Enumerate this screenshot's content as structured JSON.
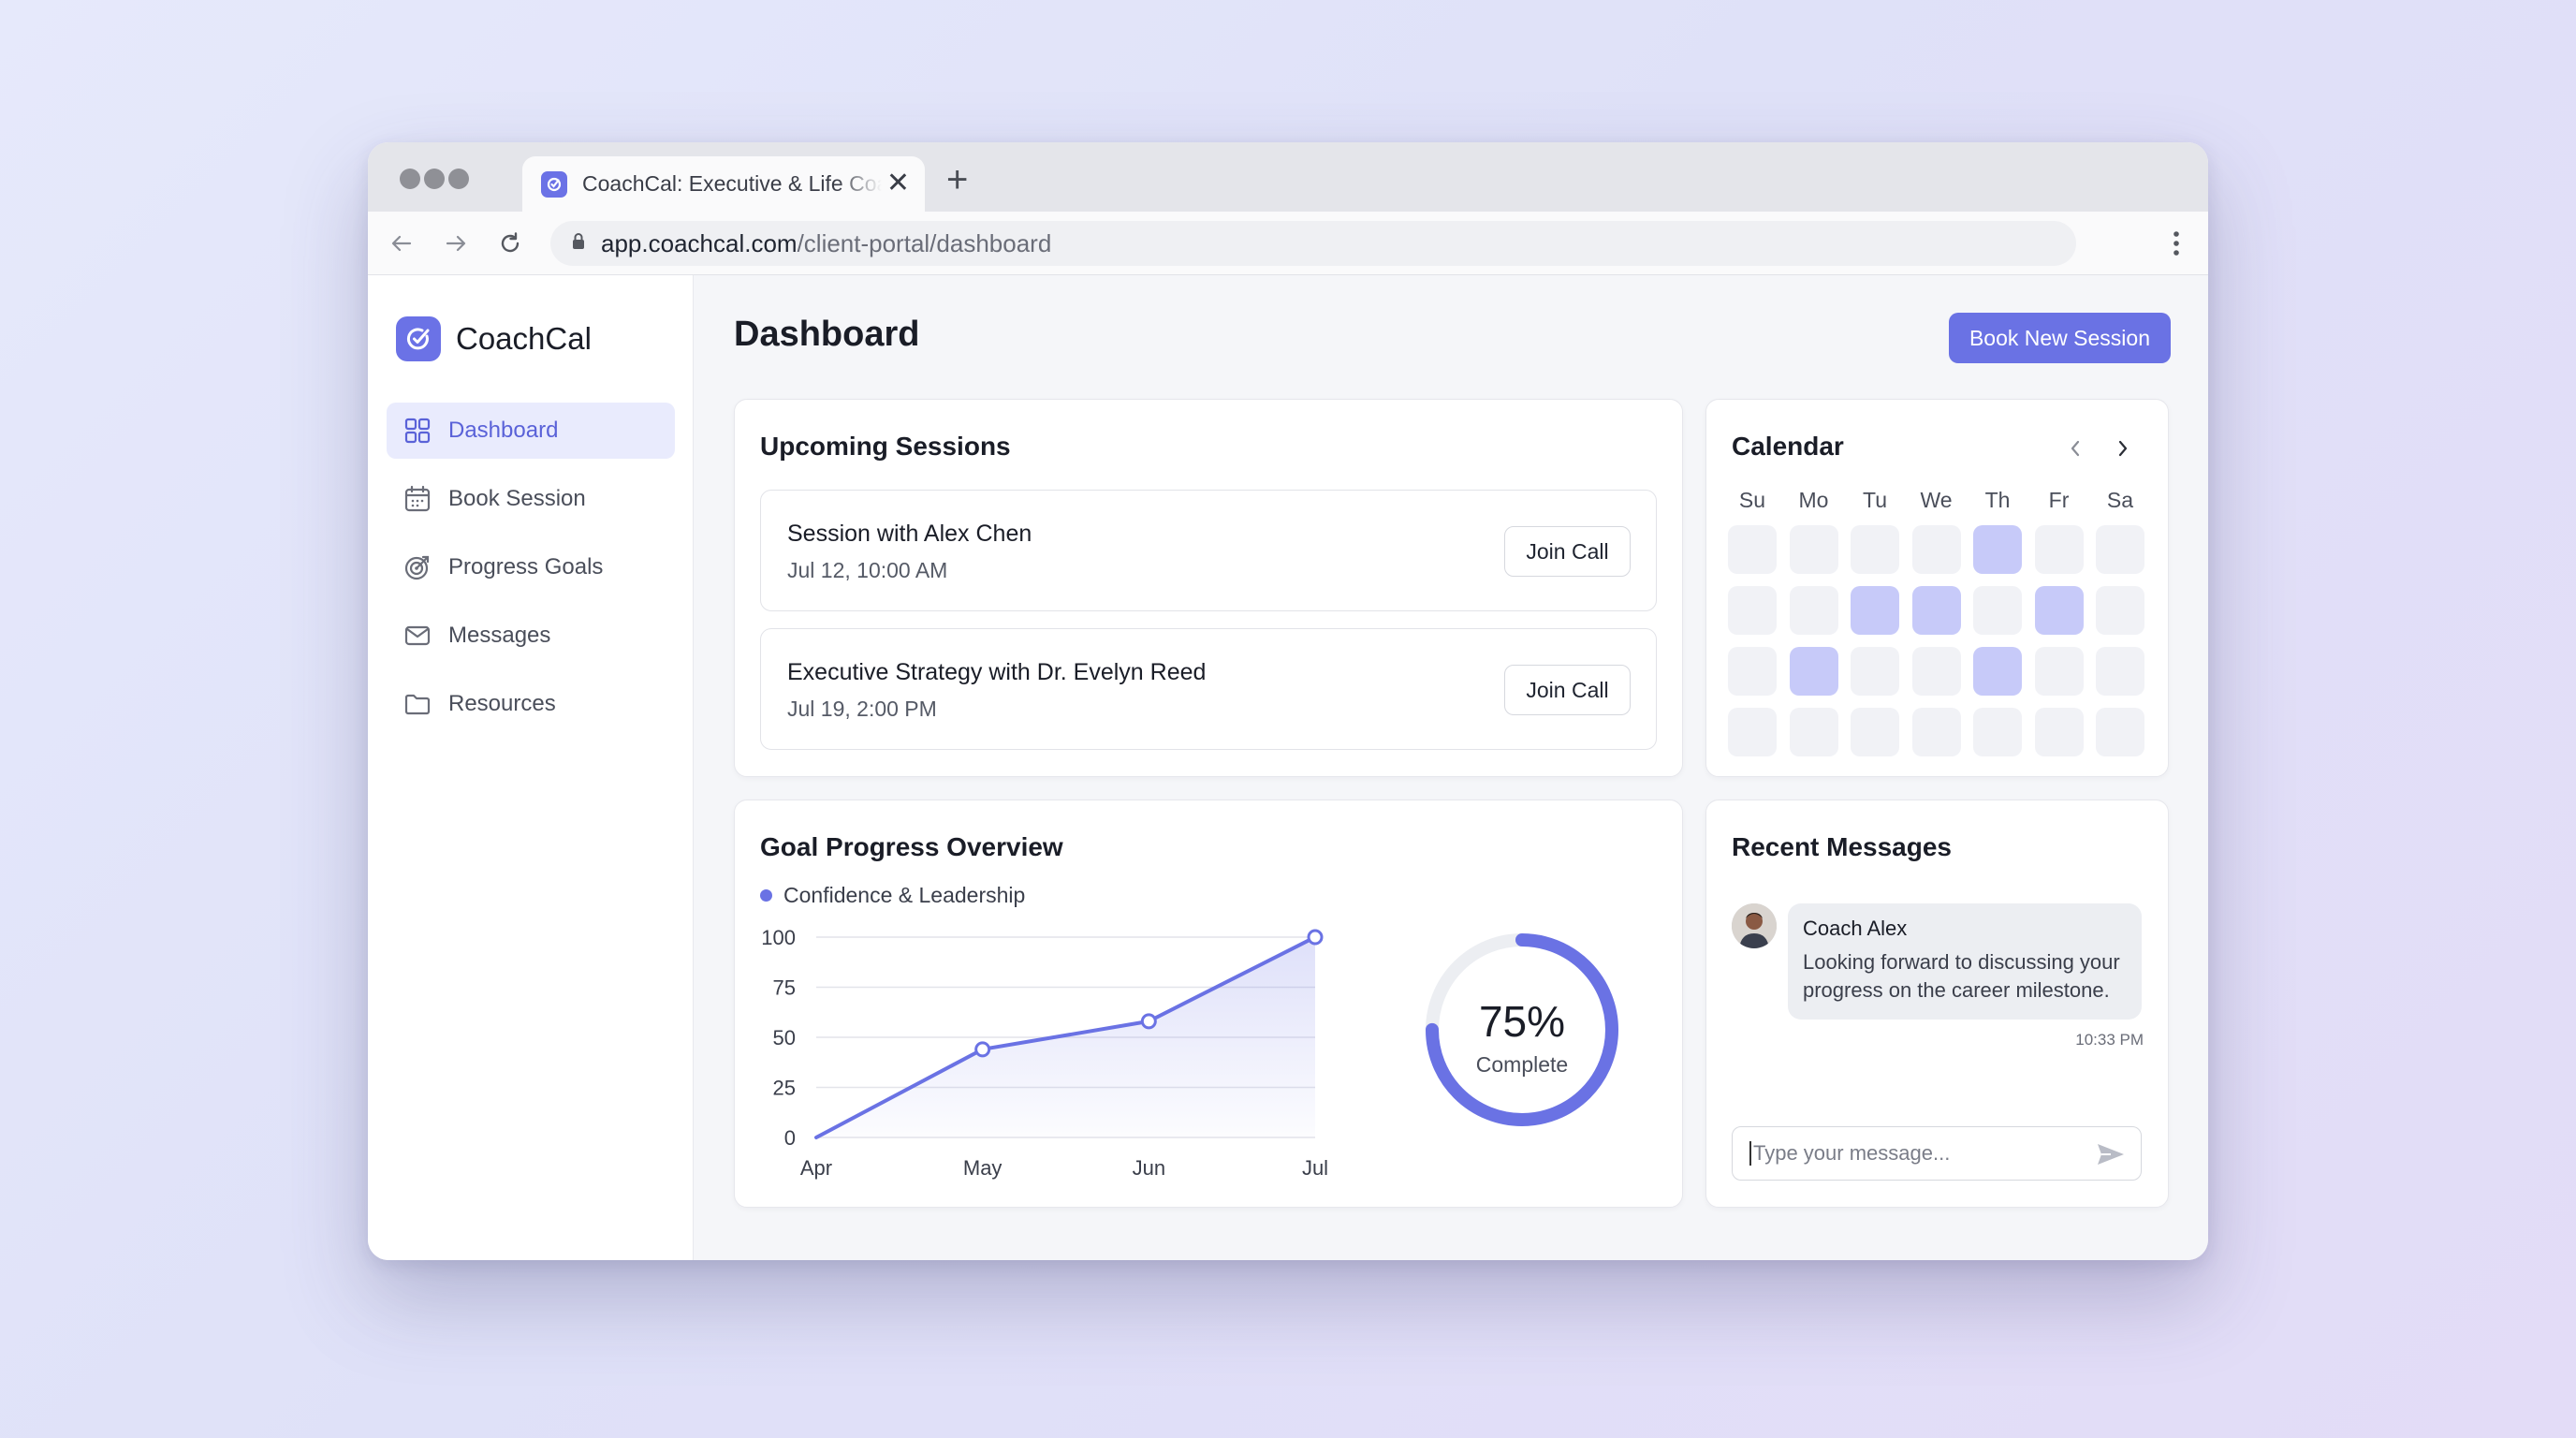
{
  "browser": {
    "tab_title": "CoachCal: Executive & Life Coaching",
    "tab_close": "✕",
    "new_tab": "+",
    "url_domain": "app.coachcal.com",
    "url_path": "/client-portal/dashboard"
  },
  "sidebar": {
    "brand": "CoachCal",
    "items": [
      {
        "label": "Dashboard",
        "icon": "grid-icon",
        "active": true
      },
      {
        "label": "Book Session",
        "icon": "calendar-icon",
        "active": false
      },
      {
        "label": "Progress Goals",
        "icon": "target-icon",
        "active": false
      },
      {
        "label": "Messages",
        "icon": "mail-icon",
        "active": false
      },
      {
        "label": "Resources",
        "icon": "folder-icon",
        "active": false
      }
    ]
  },
  "header": {
    "title": "Dashboard",
    "book_button": "Book New Session"
  },
  "upcoming": {
    "title": "Upcoming Sessions",
    "sessions": [
      {
        "name": "Session with Alex Chen",
        "time": "Jul 12, 10:00 AM",
        "action": "Join Call"
      },
      {
        "name": "Executive Strategy with Dr. Evelyn Reed",
        "time": "Jul 19, 2:00 PM",
        "action": "Join Call"
      }
    ]
  },
  "calendar": {
    "title": "Calendar",
    "days": [
      "Su",
      "Mo",
      "Tu",
      "We",
      "Th",
      "Fr",
      "Sa"
    ],
    "highlighted": [
      [
        0,
        4
      ],
      [
        1,
        2
      ],
      [
        1,
        3
      ],
      [
        1,
        5
      ],
      [
        2,
        1
      ],
      [
        2,
        4
      ]
    ]
  },
  "goal": {
    "title": "Goal Progress Overview",
    "legend": "Confidence & Leadership",
    "progress_value": "75%",
    "progress_label": "Complete",
    "progress_fraction": 0.75
  },
  "chart_data": {
    "type": "area",
    "categories": [
      "Apr",
      "May",
      "Jun",
      "Jul"
    ],
    "series": [
      {
        "name": "Confidence & Leadership",
        "values": [
          0,
          44,
          58,
          100
        ]
      }
    ],
    "yticks": [
      "100",
      "75",
      "50",
      "25",
      "0"
    ],
    "ylim": [
      0,
      100
    ],
    "grid": true,
    "color": "#6a72e4"
  },
  "messages": {
    "title": "Recent Messages",
    "sender": "Coach Alex",
    "text": "Looking forward to discussing your progress on the career milestone.",
    "time": "10:33 PM",
    "input_placeholder": "Type your message..."
  },
  "colors": {
    "accent": "#6a72e4",
    "accent_soft": "#c7caf9"
  }
}
